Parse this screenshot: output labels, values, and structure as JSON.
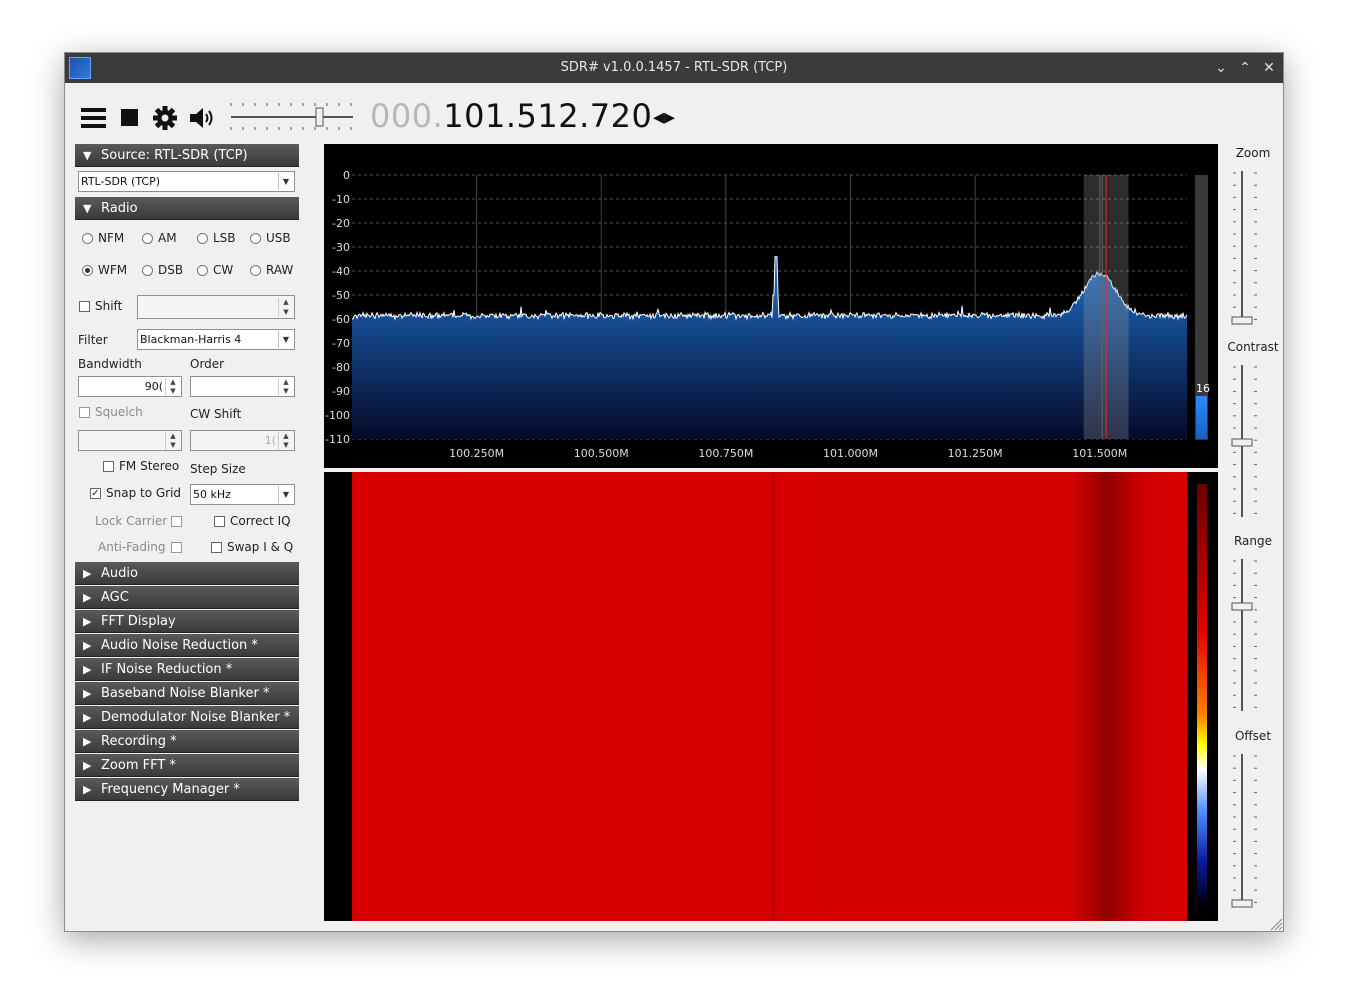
{
  "window": {
    "title": "SDR# v1.0.0.1457 - RTL-SDR (TCP)",
    "controls": {
      "minimize": "⌄",
      "maximize": "⌃",
      "close": "✕"
    }
  },
  "toolbar": {
    "icons": [
      "menu-icon",
      "stop-icon",
      "gear-icon",
      "speaker-icon"
    ],
    "volume_level": 0.7,
    "frequency_dim": "000.",
    "frequency_bright": "101.512.720",
    "tuning_arrows": "◂▸"
  },
  "source_panel": {
    "header": "Source: RTL-SDR (TCP)",
    "device": "RTL-SDR (TCP)"
  },
  "radio_panel": {
    "header": "Radio",
    "modes_row1": [
      "NFM",
      "AM",
      "LSB",
      "USB"
    ],
    "modes_row2": [
      "WFM",
      "DSB",
      "CW",
      "RAW"
    ],
    "selected_mode": "WFM",
    "shift_label": "Shift",
    "filter_label": "Filter",
    "filter_value": "Blackman-Harris 4",
    "bandwidth_label": "Bandwidth",
    "bandwidth_value": "90(",
    "order_label": "Order",
    "order_value": "",
    "squelch_label": "Squelch",
    "cw_shift_label": "CW Shift",
    "cw_shift_value": "1(",
    "fm_stereo_label": "FM Stereo",
    "step_size_label": "Step Size",
    "snap_label": "Snap to Grid",
    "step_value": "50 kHz",
    "lock_carrier_label": "Lock Carrier",
    "correct_iq_label": "Correct IQ",
    "anti_fading_label": "Anti-Fading",
    "swap_iq_label": "Swap I & Q"
  },
  "collapsed_panels": [
    "Audio",
    "AGC",
    "FFT Display",
    "Audio Noise Reduction *",
    "IF Noise Reduction *",
    "Baseband Noise Blanker *",
    "Demodulator Noise Blanker *",
    "Recording *",
    "Zoom FFT *",
    "Frequency Manager *"
  ],
  "chart_data": {
    "type": "area",
    "y_ticks": [
      "0",
      "-10",
      "-20",
      "-30",
      "-40",
      "-50",
      "-60",
      "-70",
      "-80",
      "-90",
      "-100",
      "-110"
    ],
    "x_ticks": [
      "100.250M",
      "100.500M",
      "100.750M",
      "101.000M",
      "101.250M",
      "101.500M"
    ],
    "ylim": [
      -110,
      0
    ],
    "noise_floor_db": -59,
    "peaks": [
      {
        "freq_mhz": 100.85,
        "db": -34
      },
      {
        "freq_mhz": 101.5,
        "db": -41
      }
    ],
    "tuned_freq_mhz": 101.5127,
    "level_value": "16",
    "colors": {
      "fill_top": "#1e6fc8",
      "fill_bottom": "#050a2a",
      "waterfall": "#d40000"
    }
  },
  "side_controls": {
    "zoom": "Zoom",
    "contrast": "Contrast",
    "range": "Range",
    "offset": "Offset"
  }
}
